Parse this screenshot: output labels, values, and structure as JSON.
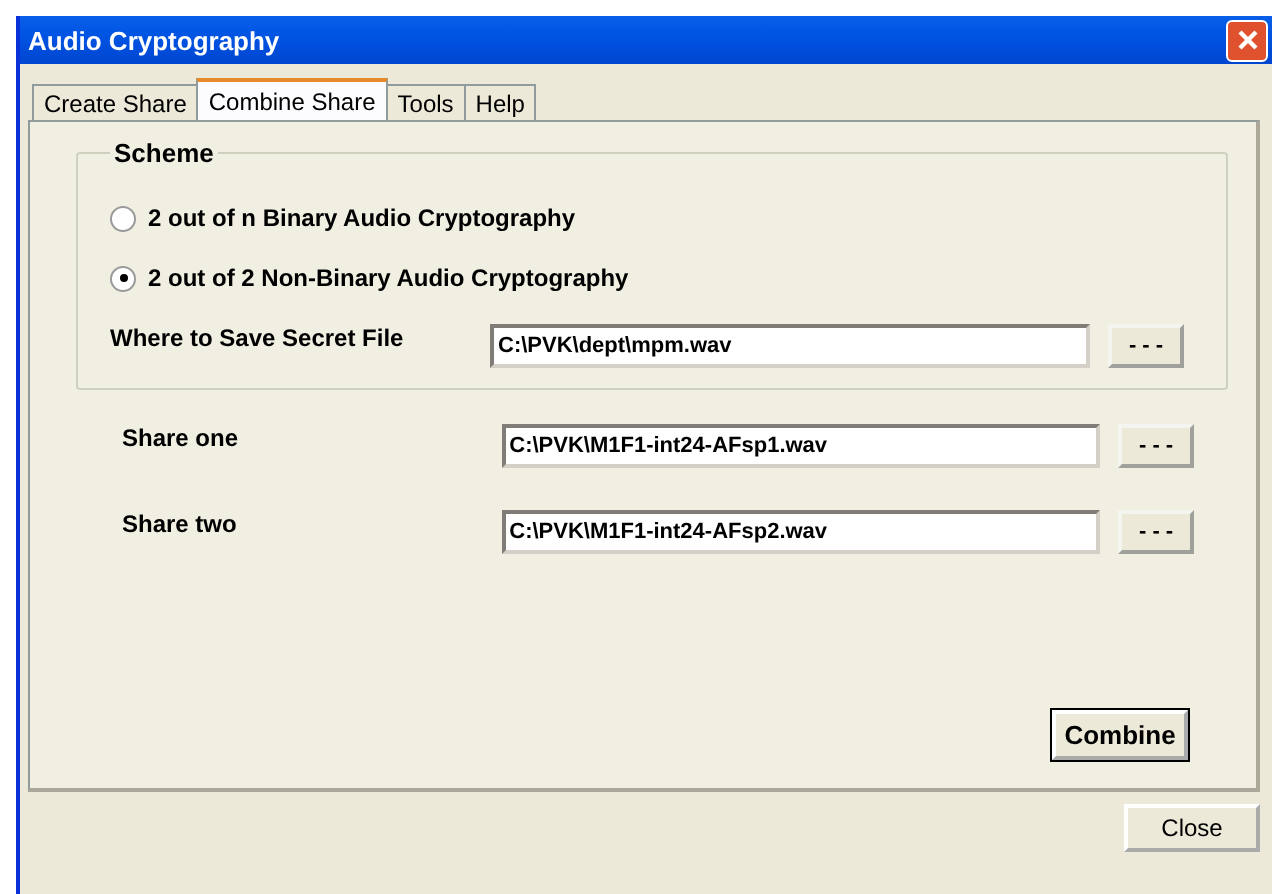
{
  "window": {
    "title": "Audio Cryptography"
  },
  "tabs": [
    {
      "label": "Create Share",
      "selected": false
    },
    {
      "label": "Combine Share",
      "selected": true
    },
    {
      "label": "Tools",
      "selected": false
    },
    {
      "label": "Help",
      "selected": false
    }
  ],
  "scheme": {
    "title": "Scheme",
    "options": [
      {
        "label": "2 out of n Binary Audio Cryptography",
        "selected": false
      },
      {
        "label": "2 out of 2 Non-Binary Audio Cryptography",
        "selected": true
      }
    ],
    "save_file": {
      "label": "Where to Save Secret File",
      "value": "C:\\PVK\\dept\\mpm.wav",
      "browse": "- - -"
    }
  },
  "shares": [
    {
      "label": "Share one",
      "value": "C:\\PVK\\M1F1-int24-AFsp1.wav",
      "browse": "- - -"
    },
    {
      "label": "Share two",
      "value": "C:\\PVK\\M1F1-int24-AFsp2.wav",
      "browse": "- - -"
    }
  ],
  "combine_button": "Combine",
  "close_button": "Close"
}
